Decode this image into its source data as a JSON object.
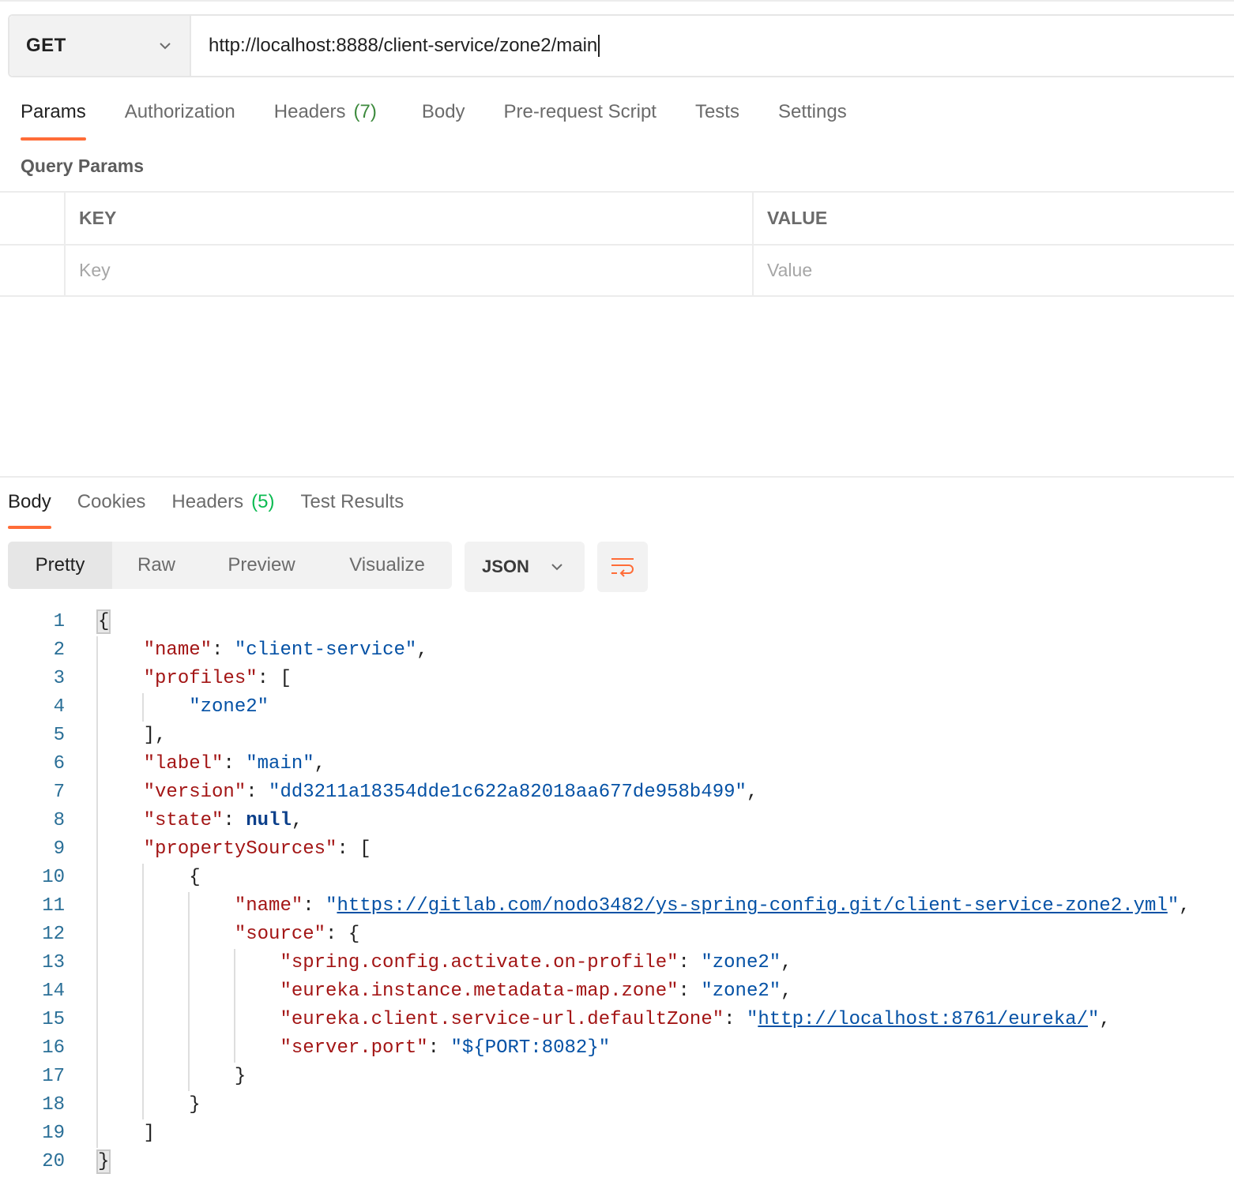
{
  "request": {
    "method": "GET",
    "url": "http://localhost:8888/client-service/zone2/main"
  },
  "request_tabs": {
    "params": "Params",
    "authorization": "Authorization",
    "headers": "Headers",
    "headers_count": "(7)",
    "body": "Body",
    "pre_request": "Pre-request Script",
    "tests": "Tests",
    "settings": "Settings",
    "active": "Params"
  },
  "query_params": {
    "title": "Query Params",
    "key_header": "KEY",
    "value_header": "VALUE",
    "key_placeholder": "Key",
    "value_placeholder": "Value"
  },
  "response_tabs": {
    "body": "Body",
    "cookies": "Cookies",
    "headers": "Headers",
    "headers_count": "(5)",
    "test_results": "Test Results",
    "active": "Body"
  },
  "view_modes": {
    "pretty": "Pretty",
    "raw": "Raw",
    "preview": "Preview",
    "visualize": "Visualize",
    "active": "Pretty"
  },
  "format": "JSON",
  "icons": {
    "method_dropdown": "chevron-down-icon",
    "format_dropdown": "chevron-down-icon",
    "wrap": "wrap-lines-icon"
  },
  "colors": {
    "accent": "#ff6c37",
    "json_key": "#a31515",
    "json_string": "#0451a5",
    "line_number": "#2a6f97"
  },
  "response_body": {
    "line_numbers": [
      "1",
      "2",
      "3",
      "4",
      "5",
      "6",
      "7",
      "8",
      "9",
      "10",
      "11",
      "12",
      "13",
      "14",
      "15",
      "16",
      "17",
      "18",
      "19",
      "20"
    ],
    "open_brace": "{",
    "close_brace": "}",
    "name_key": "\"name\"",
    "name_value": "\"client-service\"",
    "profiles_key": "\"profiles\"",
    "profile_0": "\"zone2\"",
    "label_key": "\"label\"",
    "label_value": "\"main\"",
    "version_key": "\"version\"",
    "version_value": "\"dd3211a18354dde1c622a82018aa677de958b499\"",
    "state_key": "\"state\"",
    "state_value": "null",
    "property_sources_key": "\"propertySources\"",
    "ps_name_key": "\"name\"",
    "ps_name_value": "https://gitlab.com/nodo3482/ys-spring-config.git/client-service-zone2.yml",
    "source_key": "\"source\"",
    "src_profile_key": "\"spring.config.activate.on-profile\"",
    "src_profile_value": "\"zone2\"",
    "src_zone_key": "\"eureka.instance.metadata-map.zone\"",
    "src_zone_value": "\"zone2\"",
    "src_default_zone_key": "\"eureka.client.service-url.defaultZone\"",
    "src_default_zone_value": "http://localhost:8761/eureka/",
    "src_port_key": "\"server.port\"",
    "src_port_value": "\"${PORT:8082}\""
  }
}
